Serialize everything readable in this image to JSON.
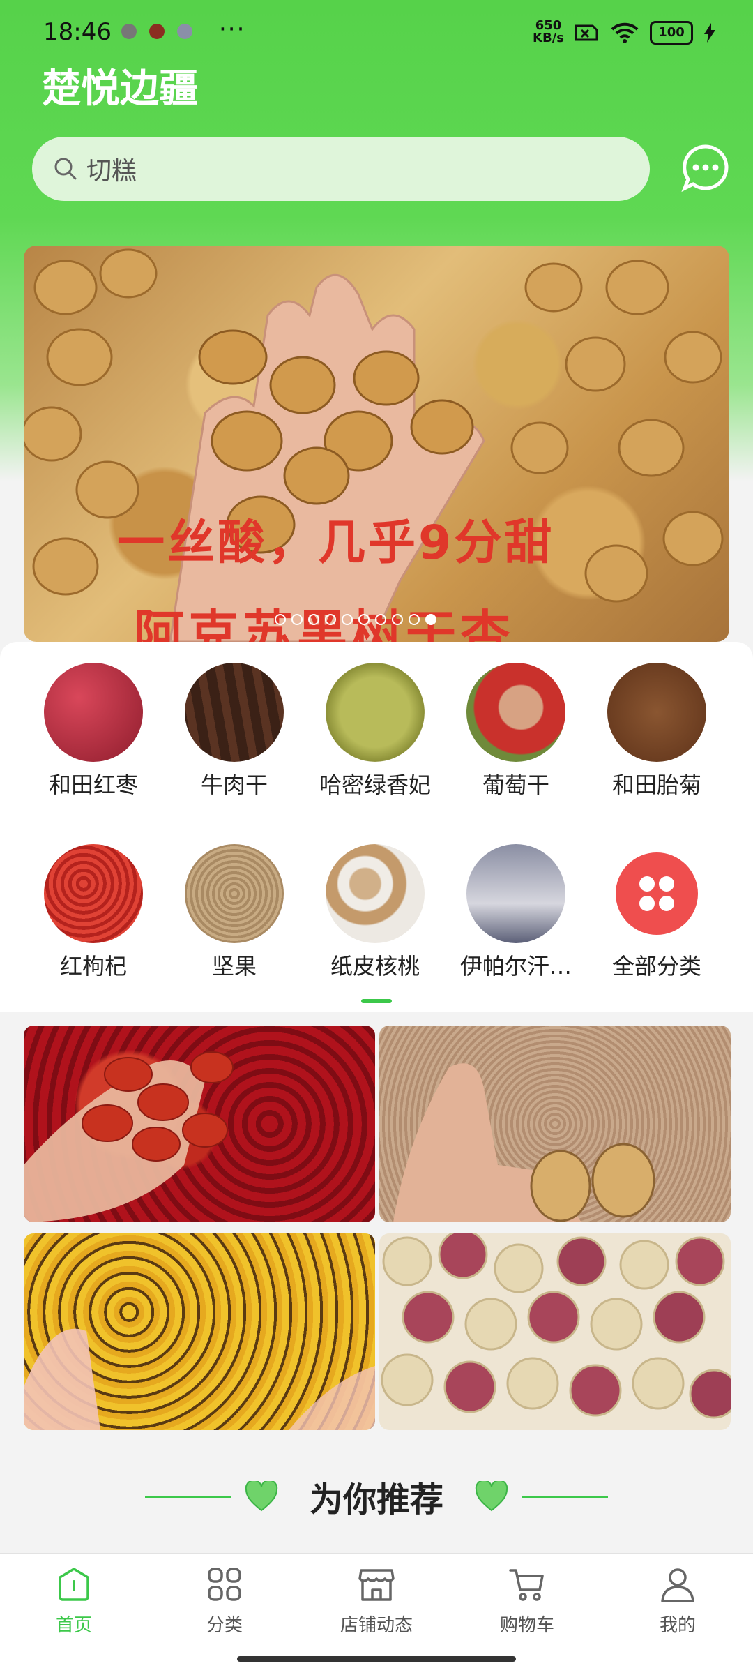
{
  "status_bar": {
    "time": "18:46",
    "net_speed_top": "650",
    "net_speed_bottom": "KB/s",
    "battery": "100",
    "more": "···"
  },
  "app": {
    "title": "楚悦边疆"
  },
  "search": {
    "value": "切糕"
  },
  "banner": {
    "caption_line1": "一丝酸，几乎9分甜",
    "caption_line2": "阿克苏黑树干杏",
    "pager": {
      "count": 10,
      "active": 9
    }
  },
  "categories": [
    {
      "label": "和田红枣",
      "icon": "red-dates-image",
      "color": "#b3263a"
    },
    {
      "label": "牛肉干",
      "icon": "beef-jerky-image",
      "color": "#4a2a1c"
    },
    {
      "label": "哈密绿香妃",
      "icon": "green-raisin-image",
      "color": "#9aa146"
    },
    {
      "label": "葡萄干",
      "icon": "raisin-farmer-image",
      "color": "#c98a5d"
    },
    {
      "label": "和田胎菊",
      "icon": "chrysanthemum-image",
      "color": "#7a4a28"
    },
    {
      "label": "红枸杞",
      "icon": "goji-image",
      "color": "#d8342c"
    },
    {
      "label": "坚果",
      "icon": "nuts-image",
      "color": "#b89a74"
    },
    {
      "label": "纸皮核桃",
      "icon": "walnut-image",
      "color": "#c7a57a"
    },
    {
      "label": "伊帕尔汗…",
      "icon": "perfume-image",
      "color": "#6b6f84"
    },
    {
      "label": "全部分类",
      "icon": "all-categories-icon",
      "color": "#ef4e4e"
    }
  ],
  "promo_tiles": [
    {
      "name": "red-dates-promo",
      "icon": "red-dates-photo"
    },
    {
      "name": "walnut-promo",
      "icon": "walnut-photo"
    },
    {
      "name": "chrysanthemum-promo",
      "icon": "chrysanthemum-photo"
    },
    {
      "name": "figs-promo",
      "icon": "dried-fig-photo"
    }
  ],
  "recommend": {
    "title": "为你推荐"
  },
  "tabbar": [
    {
      "label": "首页",
      "icon": "home-icon",
      "active": true
    },
    {
      "label": "分类",
      "icon": "grid-icon",
      "active": false
    },
    {
      "label": "店铺动态",
      "icon": "store-icon",
      "active": false
    },
    {
      "label": "购物车",
      "icon": "cart-icon",
      "active": false
    },
    {
      "label": "我的",
      "icon": "user-icon",
      "active": false
    }
  ],
  "colors": {
    "brand": "#56d24a",
    "accent_green": "#3cc84a",
    "banner_text": "#e0372a"
  }
}
